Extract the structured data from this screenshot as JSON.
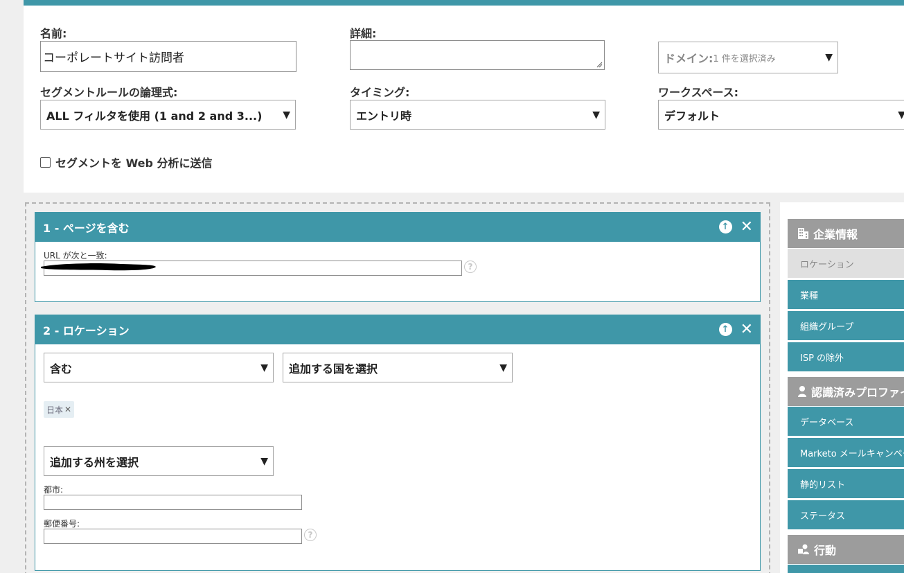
{
  "form": {
    "name_label": "名前:",
    "name_value": "コーポレートサイト訪問者",
    "detail_label": "詳細:",
    "domain_label": "ドメイン:",
    "domain_value": "1 件を選択済み",
    "logic_label": "セグメントルールの論理式:",
    "logic_value": "ALL フィルタを使用 (1 and 2 and 3...)",
    "timing_label": "タイミング:",
    "timing_value": "エントリ時",
    "workspace_label": "ワークスペース:",
    "workspace_value": "デフォルト",
    "send_checkbox_label": "セグメントを Web 分析に送信",
    "send_checked": false
  },
  "rules": [
    {
      "title": "1 - ページを含む",
      "url_label": "URL が次と一致:"
    },
    {
      "title": "2 - ロケーション",
      "operator": "含む",
      "country_placeholder": "追加する国を選択",
      "selected_countries": [
        "日本"
      ],
      "state_placeholder": "追加する州を選択",
      "city_label": "都市:",
      "zip_label": "郵便番号:"
    }
  ],
  "icons": {
    "arrow": "▼",
    "up": "↑",
    "close": "✕",
    "help": "?"
  },
  "sidebar": {
    "sections": [
      {
        "title": "企業情報",
        "icon": "building-icon",
        "items": [
          "ロケーション",
          "業種",
          "組織グループ",
          "ISP の除外"
        ],
        "selected_index": 0
      },
      {
        "title": "認識済みプロファイル",
        "icon": "person-icon",
        "items": [
          "データベース",
          "Marketo メールキャンペーン",
          "静的リスト",
          "ステータス"
        ]
      },
      {
        "title": "行動",
        "icon": "behavior-icon",
        "items": []
      }
    ]
  },
  "colors": {
    "accent": "#3f97a8",
    "sidebar_header": "#9c9c9c"
  }
}
